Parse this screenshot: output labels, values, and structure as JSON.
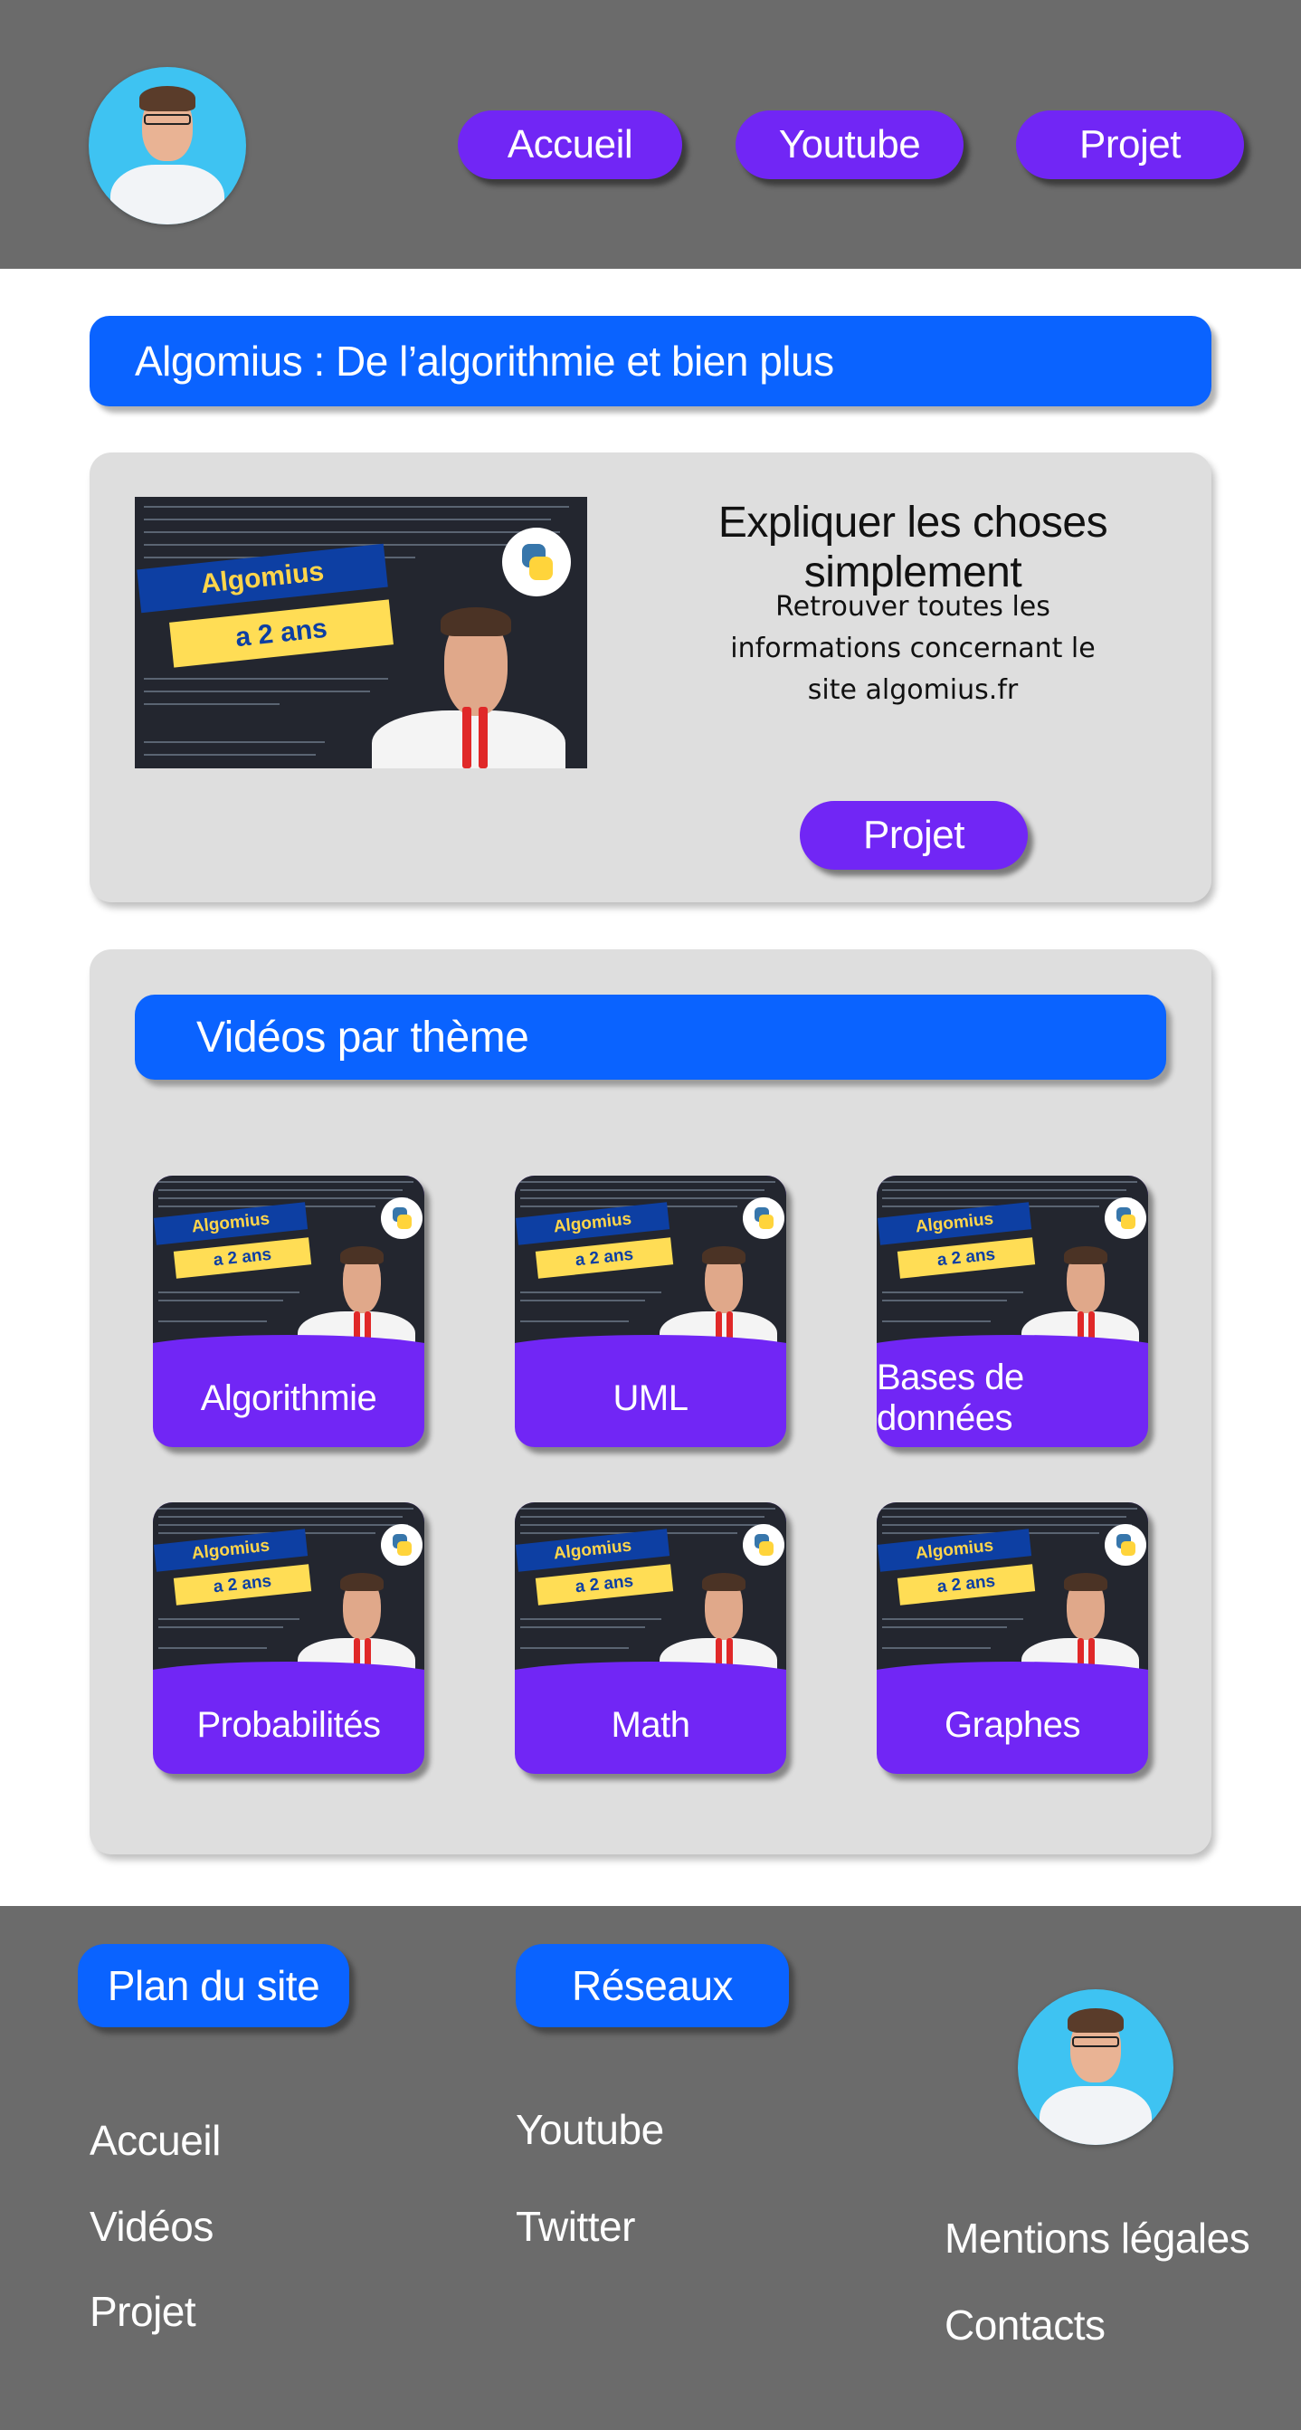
{
  "header": {
    "nav": [
      {
        "label": "Accueil"
      },
      {
        "label": "Youtube"
      },
      {
        "label": "Projet"
      }
    ]
  },
  "banner": {
    "title": "Algomius : De l’algorithmie et bien plus"
  },
  "intro": {
    "thumbnail": {
      "line1": "Algomius",
      "line2": "a 2 ans"
    },
    "heading": "Expliquer les choses simplement",
    "text": "Retrouver toutes les informations concernant le site algomius.fr",
    "button": "Projet"
  },
  "themes": {
    "title": "Vidéos par thème",
    "thumbnail": {
      "line1": "Algomius",
      "line2": "a 2 ans"
    },
    "items": [
      {
        "label": "Algorithmie"
      },
      {
        "label": "UML"
      },
      {
        "label": "Bases de données"
      },
      {
        "label": "Probabilités"
      },
      {
        "label": "Math"
      },
      {
        "label": "Graphes"
      }
    ]
  },
  "footer": {
    "plan_title": "Plan du site",
    "plan_links": [
      "Accueil",
      "Vidéos",
      "Projet"
    ],
    "social_title": "Réseaux",
    "social_links": [
      "Youtube",
      "Twitter"
    ],
    "legal_links": [
      "Mentions légales",
      "Contacts"
    ]
  },
  "colors": {
    "header_bg": "#6b6b6b",
    "accent_purple": "#7126f5",
    "accent_blue": "#0a63ff",
    "card_bg": "#dedede"
  },
  "icons": [
    "avatar-photo",
    "python-logo"
  ]
}
